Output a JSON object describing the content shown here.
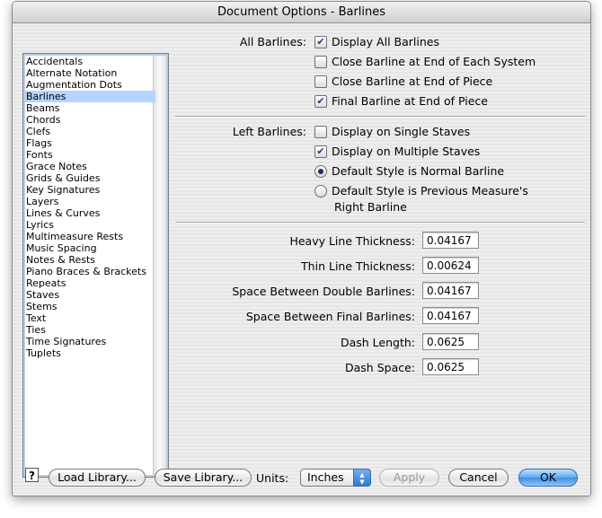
{
  "window": {
    "title": "Document Options - Barlines"
  },
  "sidebar": {
    "selected_index": 3,
    "items": [
      "Accidentals",
      "Alternate Notation",
      "Augmentation Dots",
      "Barlines",
      "Beams",
      "Chords",
      "Clefs",
      "Flags",
      "Fonts",
      "Grace Notes",
      "Grids & Guides",
      "Key Signatures",
      "Layers",
      "Lines & Curves",
      "Lyrics",
      "Multimeasure Rests",
      "Music Spacing",
      "Notes & Rests",
      "Piano Braces & Brackets",
      "Repeats",
      "Staves",
      "Stems",
      "Text",
      "Ties",
      "Time Signatures",
      "Tuplets"
    ]
  },
  "all_barlines": {
    "label": "All Barlines:",
    "options": [
      {
        "text": "Display All Barlines",
        "checked": true
      },
      {
        "text": "Close Barline at End of Each System",
        "checked": false
      },
      {
        "text": "Close Barline at End of Piece",
        "checked": false
      },
      {
        "text": "Final Barline at End of Piece",
        "checked": true
      }
    ]
  },
  "left_barlines": {
    "label": "Left Barlines:",
    "options": [
      {
        "text": "Display on Single Staves",
        "checked": false
      },
      {
        "text": "Display on Multiple Staves",
        "checked": true
      }
    ],
    "radios": [
      {
        "text": "Default Style is Normal Barline",
        "selected": true
      },
      {
        "text": "Default Style is Previous Measure's",
        "text2": "Right Barline",
        "selected": false
      }
    ]
  },
  "measurements": [
    {
      "label": "Heavy Line Thickness:",
      "value": "0.04167"
    },
    {
      "label": "Thin Line Thickness:",
      "value": "0.00624"
    },
    {
      "label": "Space Between Double Barlines:",
      "value": "0.04167"
    },
    {
      "label": "Space Between Final Barlines:",
      "value": "0.04167"
    },
    {
      "label": "Dash Length:",
      "value": "0.0625"
    },
    {
      "label": "Dash Space:",
      "value": "0.0625"
    }
  ],
  "bottom": {
    "help": "?",
    "load_library": "Load Library...",
    "save_library": "Save Library...",
    "units_label": "Units:",
    "units_value": "Inches",
    "apply": "Apply",
    "cancel": "Cancel",
    "ok": "OK"
  }
}
